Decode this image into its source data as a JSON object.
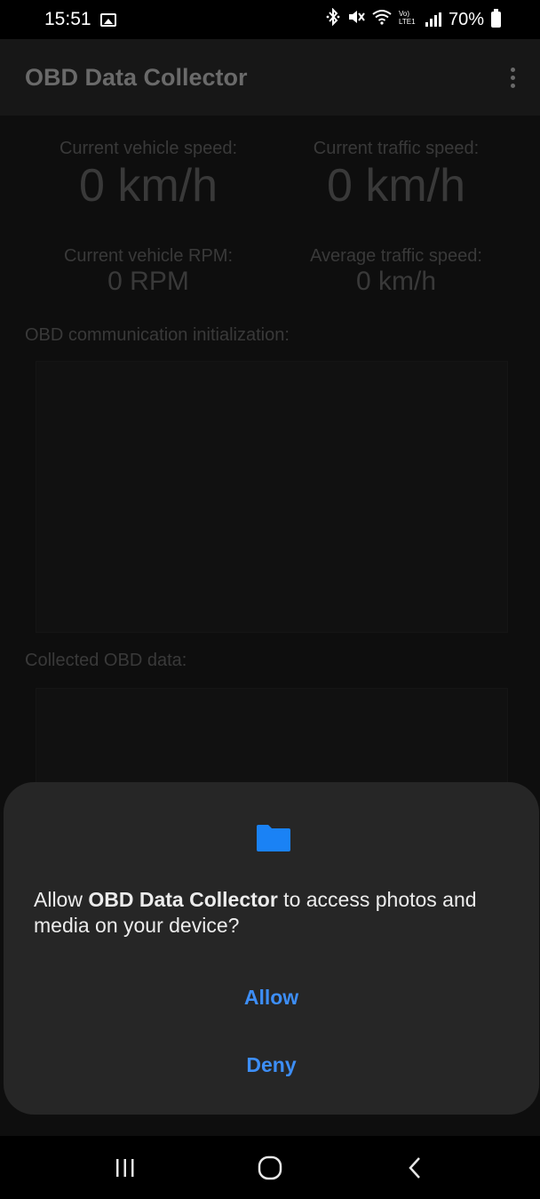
{
  "status_bar": {
    "time": "15:51",
    "battery": "70%",
    "icons": [
      "image-icon",
      "bluetooth-icon",
      "mute-icon",
      "wifi-icon",
      "volte-icon",
      "signal-icon",
      "battery-icon"
    ]
  },
  "app_bar": {
    "title": "OBD Data Collector",
    "menu_icon": "more-vert-icon"
  },
  "stats": {
    "vehicle_speed_label": "Current vehicle speed:",
    "vehicle_speed_value": "0 km/h",
    "traffic_speed_label": "Current traffic speed:",
    "traffic_speed_value": "0 km/h",
    "vehicle_rpm_label": "Current vehicle RPM:",
    "vehicle_rpm_value": "0 RPM",
    "avg_traffic_speed_label": "Average traffic speed:",
    "avg_traffic_speed_value": "0 km/h"
  },
  "sections": {
    "init_label": "OBD communication initialization:",
    "data_label": "Collected OBD data:"
  },
  "dialog": {
    "icon": "folder-icon",
    "text_prefix": "Allow ",
    "app_name": "OBD Data Collector",
    "text_suffix": " to access photos and media on your device?",
    "allow_label": "Allow",
    "deny_label": "Deny",
    "accent_color": "#3d8ef7"
  },
  "nav_bar": {
    "icons": [
      "recents-icon",
      "home-icon",
      "back-icon"
    ]
  }
}
